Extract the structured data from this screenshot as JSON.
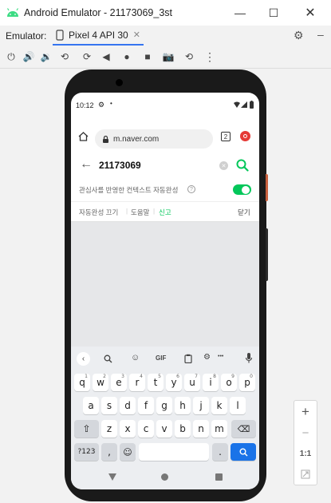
{
  "window": {
    "title": "Android Emulator - 21173069_3st"
  },
  "emulator": {
    "label": "Emulator:",
    "device_tab": "Pixel 4 API 30"
  },
  "status": {
    "time": "10:12"
  },
  "browser": {
    "url": "m.naver.com",
    "tab_count": "2"
  },
  "search": {
    "query": "21173069"
  },
  "options": {
    "autocomplete_text": "관심사를 반영한 컨텍스트 자동완성",
    "toggle_on": true
  },
  "links": {
    "off": "자동완성 끄기",
    "help": "도움말",
    "report": "신고",
    "close": "닫기"
  },
  "keyboard": {
    "toolbar": {
      "gif": "GIF",
      "more": "•••"
    },
    "row1": [
      {
        "k": "q",
        "h": "1"
      },
      {
        "k": "w",
        "h": "2"
      },
      {
        "k": "e",
        "h": "3"
      },
      {
        "k": "r",
        "h": "4"
      },
      {
        "k": "t",
        "h": "5"
      },
      {
        "k": "y",
        "h": "6"
      },
      {
        "k": "u",
        "h": "7"
      },
      {
        "k": "i",
        "h": "8"
      },
      {
        "k": "o",
        "h": "9"
      },
      {
        "k": "p",
        "h": "0"
      }
    ],
    "row2": [
      "a",
      "s",
      "d",
      "f",
      "g",
      "h",
      "j",
      "k",
      "l"
    ],
    "row3": [
      "z",
      "x",
      "c",
      "v",
      "b",
      "n",
      "m"
    ],
    "sym": "?123",
    "comma": ",",
    "period": "."
  },
  "zoom": {
    "plus": "+",
    "minus": "−",
    "ratio": "1:1"
  },
  "colors": {
    "accent": "#03c75a",
    "android_green": "#3ddc84",
    "tab_underline": "#3574f0",
    "search_blue": "#1a73e8"
  }
}
